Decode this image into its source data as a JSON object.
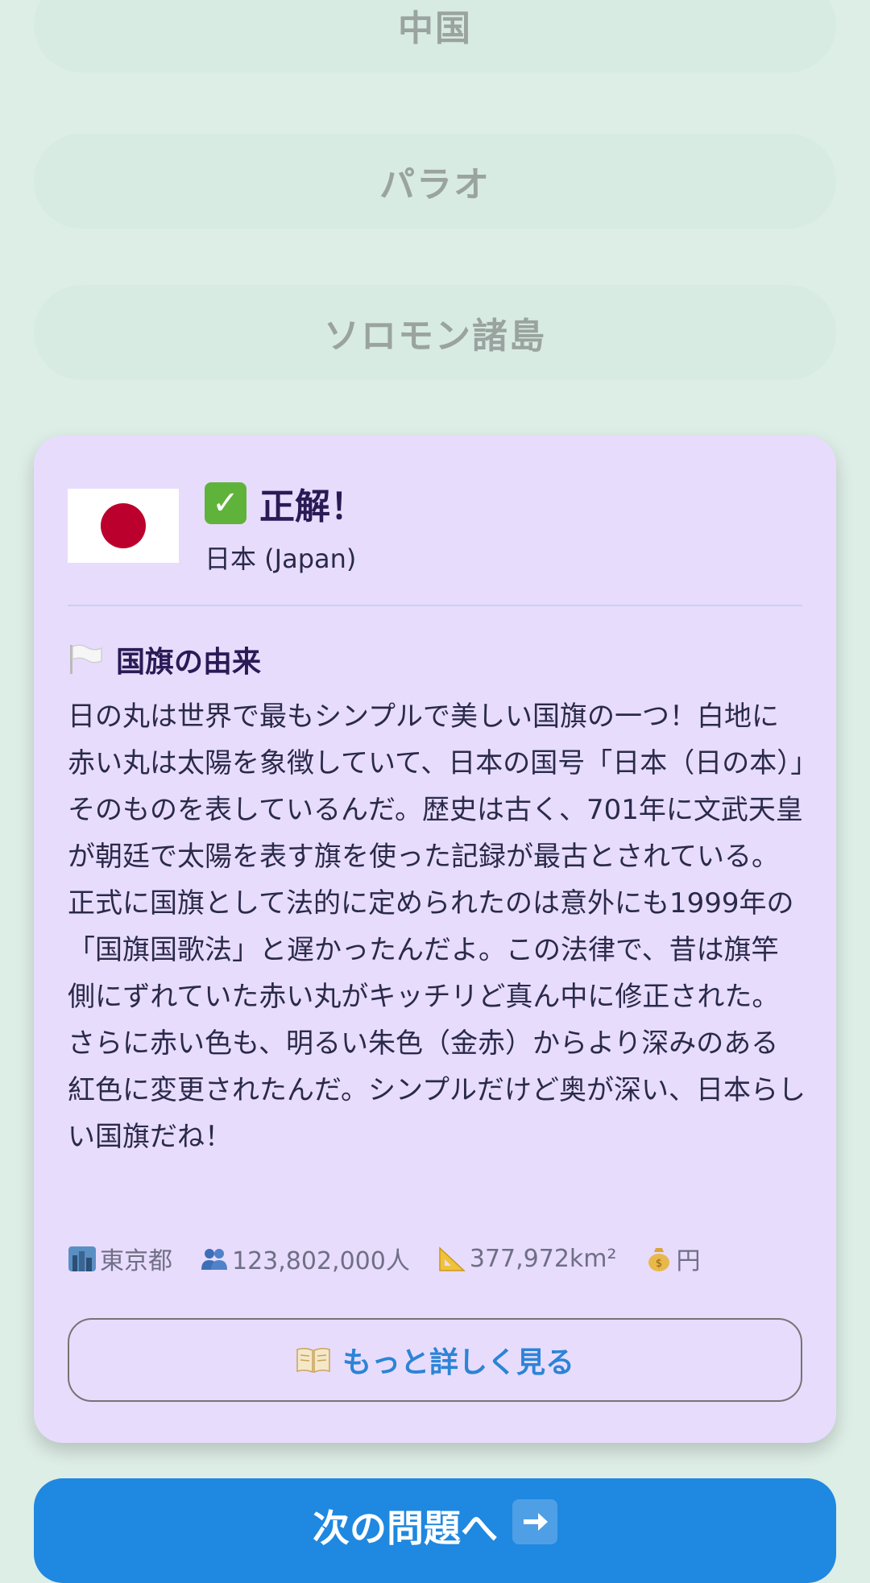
{
  "options": [
    {
      "label": "中国"
    },
    {
      "label": "パラオ"
    },
    {
      "label": "ソロモン諸島"
    }
  ],
  "result": {
    "title": "正解！",
    "country": "日本 (Japan)",
    "section_title": "国旗の由来",
    "description": "日の丸は世界で最もシンプルで美しい国旗の一つ！白地に赤い丸は太陽を象徴していて、日本の国号「日本（日の本）」そのものを表しているんだ。歴史は古く、701年に文武天皇が朝廷で太陽を表す旗を使った記録が最古とされている。正式に国旗として法的に定められたのは意外にも1999年の「国旗国歌法」と遅かったんだよ。この法律で、昔は旗竿側にずれていた赤い丸がキッチリど真ん中に修正された。さらに赤い色も、明るい朱色（金赤）からより深みのある紅色に変更されたんだ。シンプルだけど奥が深い、日本らしい国旗だね！",
    "stats": {
      "capital": "東京都",
      "population": "123,802,000人",
      "area": "377,972km²",
      "currency": "円"
    },
    "more_label": "もっと詳しく見る"
  },
  "next_label": "次の問題へ",
  "colors": {
    "background": "#ddeee6",
    "card": "#e8dcfd",
    "accent": "#1f88e0",
    "flag_red": "#bc002d"
  },
  "icons": {
    "check": "check-mark-icon",
    "flag": "white-flag-icon",
    "capital": "cityscape-icon",
    "population": "people-icon",
    "area": "triangle-ruler-icon",
    "currency": "money-bag-icon",
    "book": "open-book-icon",
    "arrow": "right-arrow-icon"
  }
}
